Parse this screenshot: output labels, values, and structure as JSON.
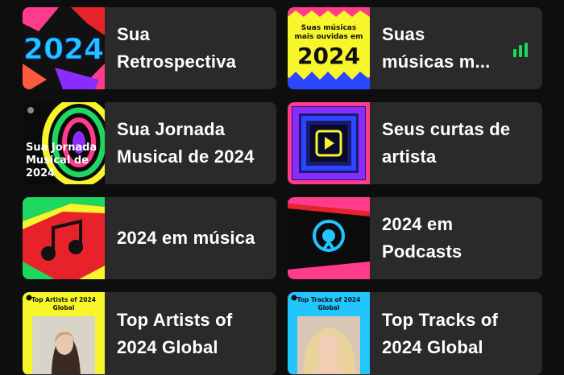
{
  "grid": [
    {
      "title": "Sua Retrospectiva",
      "lines": [
        "Sua",
        "Retrospectiva"
      ],
      "thumb": {
        "kind": "wrapped-2024",
        "big_text": "2024"
      },
      "playing": false
    },
    {
      "title": "Suas músicas m...",
      "lines": [
        "Suas",
        "músicas m..."
      ],
      "thumb": {
        "kind": "top-songs",
        "small_line1": "Suas músicas",
        "small_line2": "mais ouvidas em",
        "big_text": "2024"
      },
      "playing": true
    },
    {
      "title": "Sua Jornada Musical de 2024",
      "lines": [
        "Sua Jornada",
        "Musical de 2024"
      ],
      "thumb": {
        "kind": "journey",
        "line1": "Sua Jornada",
        "line2": "Musical de",
        "line3": "2024"
      },
      "playing": false
    },
    {
      "title": "Seus curtas de artista",
      "lines": [
        "Seus curtas de",
        "artista"
      ],
      "thumb": {
        "kind": "shorts",
        "icon": "play-square-icon"
      },
      "playing": false
    },
    {
      "title": "2024 em música",
      "lines": [
        "2024 em música"
      ],
      "thumb": {
        "kind": "music",
        "icon": "music-note-icon"
      },
      "playing": false
    },
    {
      "title": "2024 em Podcasts",
      "lines": [
        "2024 em",
        "Podcasts"
      ],
      "thumb": {
        "kind": "podcasts",
        "icon": "podcast-icon"
      },
      "playing": false
    },
    {
      "title": "Top Artists of 2024 Global",
      "lines": [
        "Top Artists of",
        "2024 Global"
      ],
      "thumb": {
        "kind": "top-artists",
        "line1": "Top Artists of 2024",
        "line2": "Global"
      },
      "playing": false
    },
    {
      "title": "Top Tracks of 2024 Global",
      "lines": [
        "Top Tracks of",
        "2024 Global"
      ],
      "thumb": {
        "kind": "top-tracks",
        "line1": "Top Tracks of 2024",
        "line2": "Global"
      },
      "playing": false
    }
  ],
  "colors": {
    "background": "#0e0e0e",
    "card": "#2a2a2a",
    "text": "#ffffff",
    "accent_green": "#1ed760",
    "wrapped_yellow": "#f6f62a",
    "wrapped_pink": "#ff3c8c",
    "wrapped_blue": "#2d46ff",
    "wrapped_cyan": "#22c6ff",
    "wrapped_red": "#e8222a"
  }
}
